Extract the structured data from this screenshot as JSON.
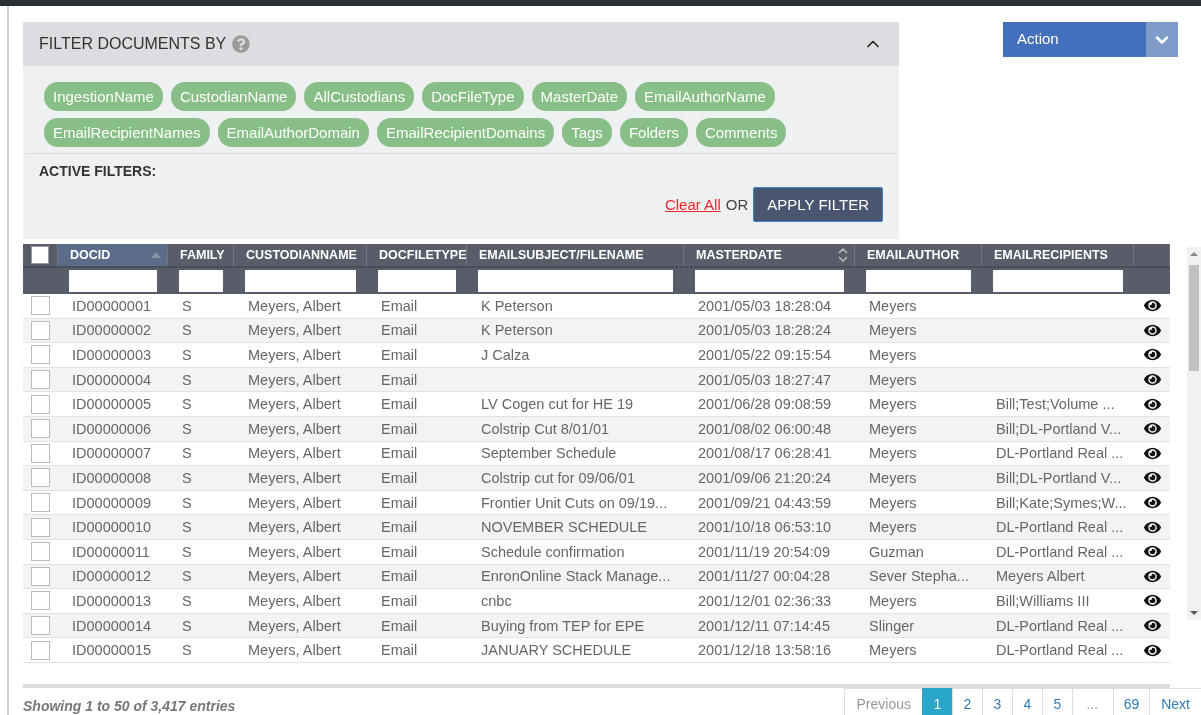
{
  "filter_panel": {
    "title": "FILTER DOCUMENTS BY",
    "expanded": true,
    "fields": [
      "IngestionName",
      "CustodianName",
      "AllCustodians",
      "DocFileType",
      "MasterDate",
      "EmailAuthorName",
      "EmailRecipientNames",
      "EmailAuthorDomain",
      "EmailRecipientDomains",
      "Tags",
      "Folders",
      "Comments"
    ],
    "active_filters_label": "ACTIVE FILTERS:",
    "clear_link": "Clear All",
    "or_text": "OR",
    "apply_button": "APPLY FILTER"
  },
  "action_menu": {
    "label": "Action"
  },
  "table": {
    "select_all_checked": false,
    "columns": [
      {
        "label": "DOCID",
        "sorted": true
      },
      {
        "label": "FAMILY",
        "sorted": false
      },
      {
        "label": "CUSTODIANNAME",
        "sorted": false
      },
      {
        "label": "DOCFILETYPE",
        "sorted": false
      },
      {
        "label": "EMAILSUBJECT/FILENAME",
        "sorted": false
      },
      {
        "label": "MASTERDATE",
        "sorted": false,
        "sortable": true
      },
      {
        "label": "EMAILAUTHOR",
        "sorted": false
      },
      {
        "label": "EMAILRECIPIENTS",
        "sorted": false
      }
    ],
    "rows": [
      {
        "checked": false,
        "cells": [
          "ID00000001",
          "S",
          "Meyers, Albert",
          "Email",
          "K Peterson",
          "2001/05/03 18:28:04",
          "Meyers",
          ""
        ]
      },
      {
        "checked": false,
        "cells": [
          "ID00000002",
          "S",
          "Meyers, Albert",
          "Email",
          "K Peterson",
          "2001/05/03 18:28:24",
          "Meyers",
          ""
        ]
      },
      {
        "checked": false,
        "cells": [
          "ID00000003",
          "S",
          "Meyers, Albert",
          "Email",
          "J Calza",
          "2001/05/22 09:15:54",
          "Meyers",
          ""
        ]
      },
      {
        "checked": false,
        "cells": [
          "ID00000004",
          "S",
          "Meyers, Albert",
          "Email",
          "",
          "2001/05/03 18:27:47",
          "Meyers",
          ""
        ]
      },
      {
        "checked": false,
        "cells": [
          "ID00000005",
          "S",
          "Meyers, Albert",
          "Email",
          "LV Cogen cut for HE 19",
          "2001/06/28 09:08:59",
          "Meyers",
          "Bill;Test;Volume ..."
        ]
      },
      {
        "checked": false,
        "cells": [
          "ID00000006",
          "S",
          "Meyers, Albert",
          "Email",
          "Colstrip Cut 8/01/01",
          "2001/08/02 06:00:48",
          "Meyers",
          "Bill;DL-Portland V..."
        ]
      },
      {
        "checked": false,
        "cells": [
          "ID00000007",
          "S",
          "Meyers, Albert",
          "Email",
          "September Schedule",
          "2001/08/17 06:28:41",
          "Meyers",
          "DL-Portland Real ..."
        ]
      },
      {
        "checked": false,
        "cells": [
          "ID00000008",
          "S",
          "Meyers, Albert",
          "Email",
          "Colstrip cut for 09/06/01",
          "2001/09/06 21:20:24",
          "Meyers",
          "Bill;DL-Portland V..."
        ]
      },
      {
        "checked": false,
        "cells": [
          "ID00000009",
          "S",
          "Meyers, Albert",
          "Email",
          "Frontier Unit Cuts on 09/19...",
          "2001/09/21 04:43:59",
          "Meyers",
          "Bill;Kate;Symes;W..."
        ]
      },
      {
        "checked": false,
        "cells": [
          "ID00000010",
          "S",
          "Meyers, Albert",
          "Email",
          "NOVEMBER SCHEDULE",
          "2001/10/18 06:53:10",
          "Meyers",
          "DL-Portland Real ..."
        ]
      },
      {
        "checked": false,
        "cells": [
          "ID00000011",
          "S",
          "Meyers, Albert",
          "Email",
          "Schedule confirmation",
          "2001/11/19 20:54:09",
          "Guzman",
          "DL-Portland Real ..."
        ]
      },
      {
        "checked": false,
        "cells": [
          "ID00000012",
          "S",
          "Meyers, Albert",
          "Email",
          "EnronOnline Stack Manage...",
          "2001/11/27 00:04:28",
          "Sever Stepha...",
          "Meyers Albert"
        ]
      },
      {
        "checked": false,
        "cells": [
          "ID00000013",
          "S",
          "Meyers, Albert",
          "Email",
          "cnbc",
          "2001/12/01 02:36:33",
          "Meyers",
          "Bill;Williams III"
        ]
      },
      {
        "checked": false,
        "cells": [
          "ID00000014",
          "S",
          "Meyers, Albert",
          "Email",
          "Buying from TEP for EPE",
          "2001/12/11 07:14:45",
          "Slinger",
          "DL-Portland Real ..."
        ]
      },
      {
        "checked": false,
        "cells": [
          "ID00000015",
          "S",
          "Meyers, Albert",
          "Email",
          "JANUARY SCHEDULE",
          "2001/12/18 13:58:16",
          "Meyers",
          "DL-Portland Real ..."
        ]
      }
    ]
  },
  "footer": {
    "summary": "Showing 1 to 50 of 3,417 entries",
    "pagination": [
      {
        "label": "Previous",
        "kind": "nav",
        "disabled": true,
        "selected": false
      },
      {
        "label": "1",
        "kind": "page",
        "disabled": false,
        "selected": true
      },
      {
        "label": "2",
        "kind": "page",
        "disabled": false,
        "selected": false
      },
      {
        "label": "3",
        "kind": "page",
        "disabled": false,
        "selected": false
      },
      {
        "label": "4",
        "kind": "page",
        "disabled": false,
        "selected": false
      },
      {
        "label": "5",
        "kind": "page",
        "disabled": false,
        "selected": false
      },
      {
        "label": "...",
        "kind": "gap",
        "disabled": true,
        "selected": false
      },
      {
        "label": "69",
        "kind": "page",
        "disabled": false,
        "selected": false
      },
      {
        "label": "Next",
        "kind": "nav",
        "disabled": false,
        "selected": false
      }
    ]
  }
}
